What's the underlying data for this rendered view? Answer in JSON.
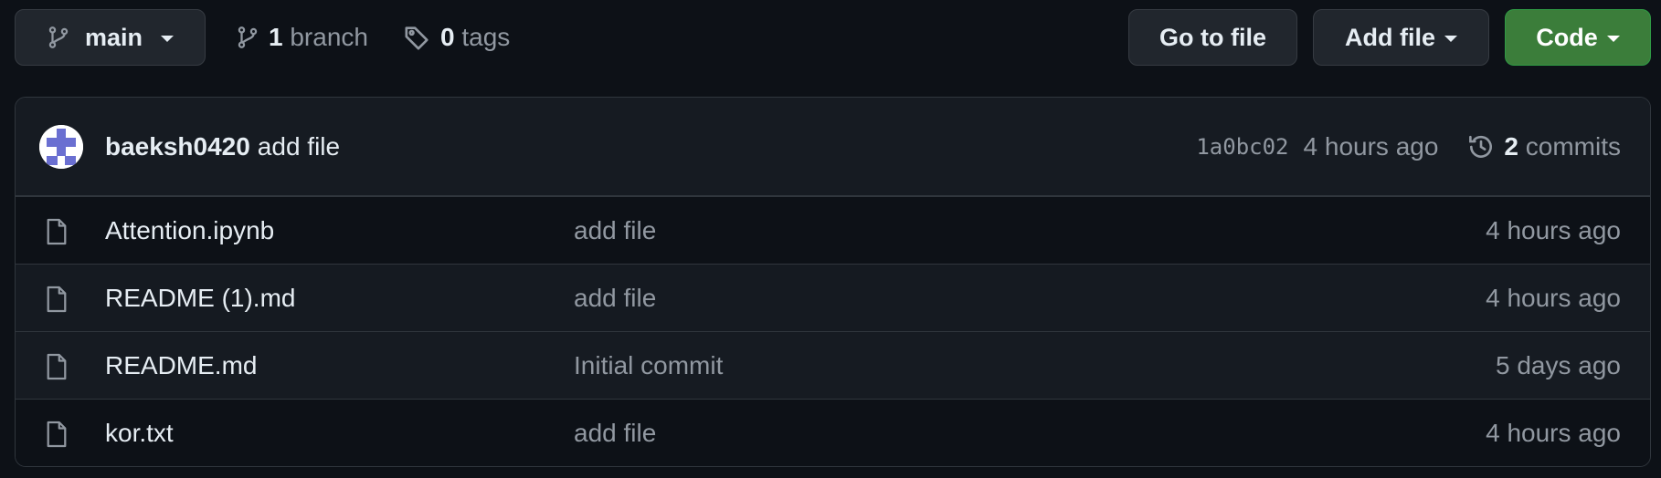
{
  "branch_selector": {
    "label": "main",
    "icon": "git-branch-icon"
  },
  "branches": {
    "count": "1",
    "label": "branch",
    "icon": "git-branch-icon"
  },
  "tags": {
    "count": "0",
    "label": "tags",
    "icon": "tag-icon"
  },
  "buttons": {
    "goto_file": "Go to file",
    "add_file": "Add file",
    "code": "Code"
  },
  "latest_commit": {
    "author": "baeksh0420",
    "message": "add file",
    "sha": "1a0bc02",
    "time": "4 hours ago",
    "commit_count": "2",
    "commit_label": "commits",
    "avatar_icon": "identicon-avatar",
    "history_icon": "history-icon"
  },
  "files": [
    {
      "name": "Attention.ipynb",
      "message": "add file",
      "time": "4 hours ago",
      "icon": "file-icon"
    },
    {
      "name": "README (1).md",
      "message": "add file",
      "time": "4 hours ago",
      "icon": "file-icon"
    },
    {
      "name": "README.md",
      "message": "Initial commit",
      "time": "5 days ago",
      "icon": "file-icon"
    },
    {
      "name": "kor.txt",
      "message": "add file",
      "time": "4 hours ago",
      "icon": "file-icon"
    }
  ],
  "colors": {
    "background": "#0d1117",
    "border": "#30363d",
    "code_button": "#3b7d3a",
    "muted_text": "#9198a1",
    "avatar_accent": "#6a6fd1"
  }
}
